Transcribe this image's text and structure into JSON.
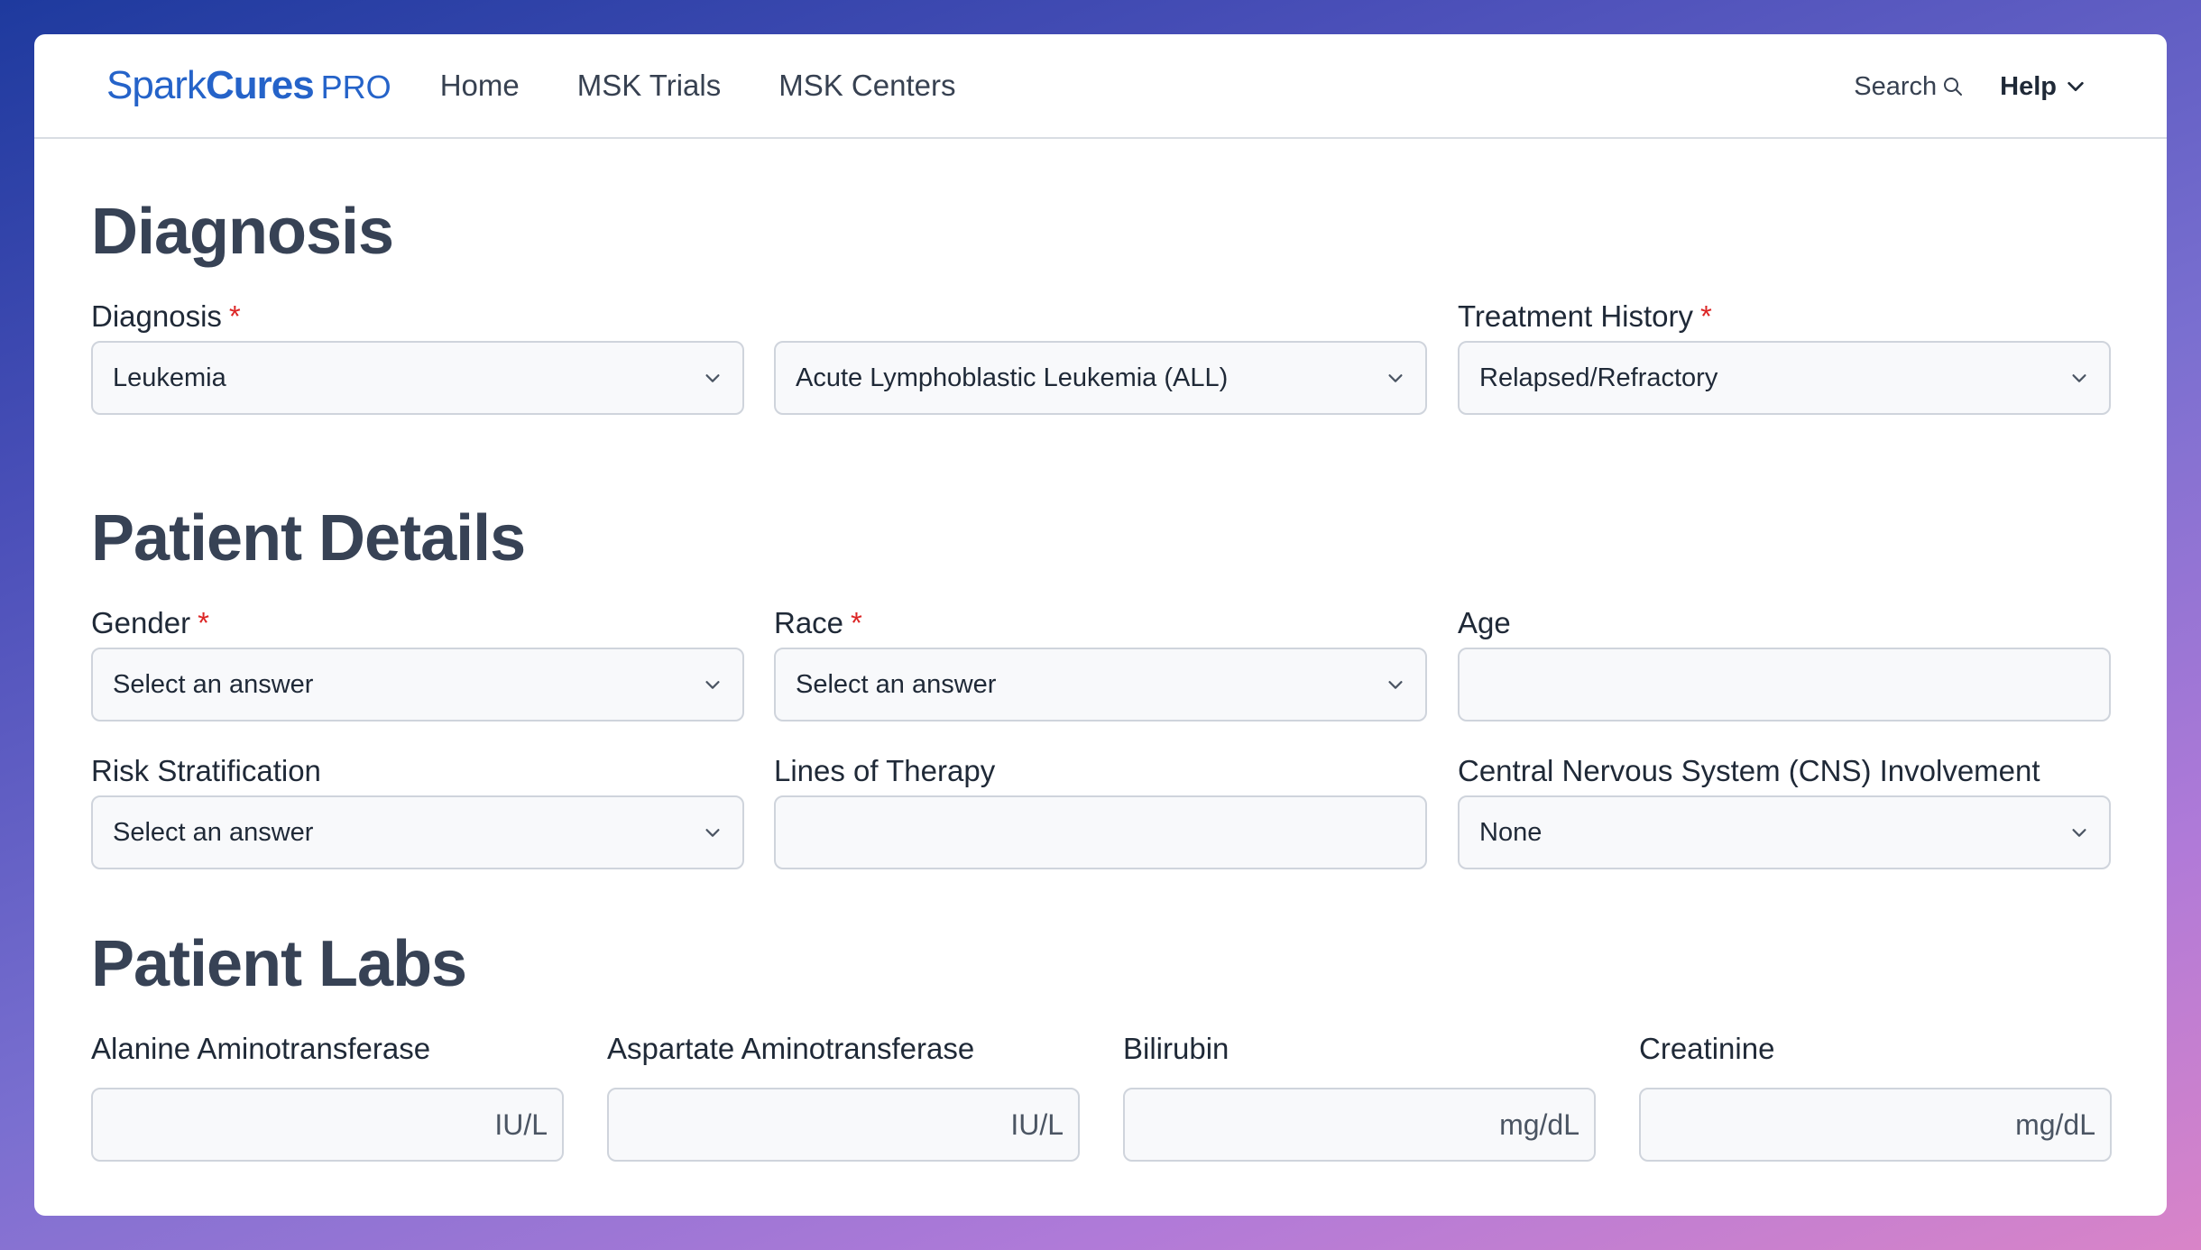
{
  "nav": {
    "logo_spark": "Spark",
    "logo_cures": "Cures",
    "logo_pro": "PRO",
    "links": [
      "Home",
      "MSK Trials",
      "MSK Centers"
    ],
    "search_label": "Search",
    "help_label": "Help"
  },
  "diagnosis": {
    "heading": "Diagnosis",
    "diagnosis_label": "Diagnosis",
    "diagnosis_value": "Leukemia",
    "subtype_value": "Acute Lymphoblastic Leukemia (ALL)",
    "treatment_label": "Treatment History",
    "treatment_value": "Relapsed/Refractory"
  },
  "patient_details": {
    "heading": "Patient Details",
    "gender_label": "Gender",
    "gender_value": "Select an answer",
    "race_label": "Race",
    "race_value": "Select an answer",
    "age_label": "Age",
    "age_value": "",
    "risk_label": "Risk Stratification",
    "risk_value": "Select an answer",
    "lines_label": "Lines of Therapy",
    "lines_value": "",
    "cns_label": "Central Nervous System (CNS) Involvement",
    "cns_value": "None"
  },
  "patient_labs": {
    "heading": "Patient Labs",
    "labs": [
      {
        "label": "Alanine Aminotransferase",
        "value": "",
        "unit": "IU/L"
      },
      {
        "label": "Aspartate Aminotransferase",
        "value": "",
        "unit": "IU/L"
      },
      {
        "label": "Bilirubin",
        "value": "",
        "unit": "mg/dL"
      },
      {
        "label": "Creatinine",
        "value": "",
        "unit": "mg/dL"
      }
    ]
  },
  "required_marker": "*",
  "colors": {
    "brand": "#2563c9",
    "required": "#dc2626",
    "heading": "#374255"
  }
}
